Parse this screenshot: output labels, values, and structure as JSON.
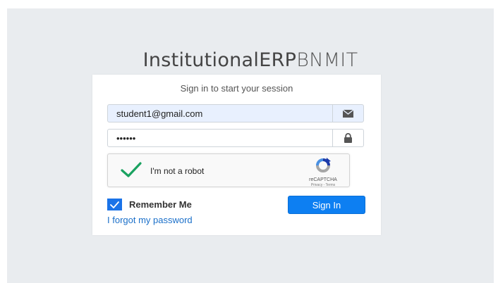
{
  "logo": {
    "bold": "Institutional",
    "mid": "ERP",
    "light": "BNMIT"
  },
  "login": {
    "message": "Sign in to start your session",
    "email_value": "student1@gmail.com",
    "password_value": "••••••",
    "remember_label": "Remember Me",
    "signin_label": "Sign In",
    "forgot_label": "I forgot my password"
  },
  "recaptcha": {
    "label": "I'm not a robot",
    "brand": "reCAPTCHA",
    "links": "Privacy - Terms"
  },
  "colors": {
    "page_bg": "#e9ecef",
    "primary": "#0d7ff2",
    "check_green": "#1aa260",
    "link": "#1a6fc9"
  }
}
